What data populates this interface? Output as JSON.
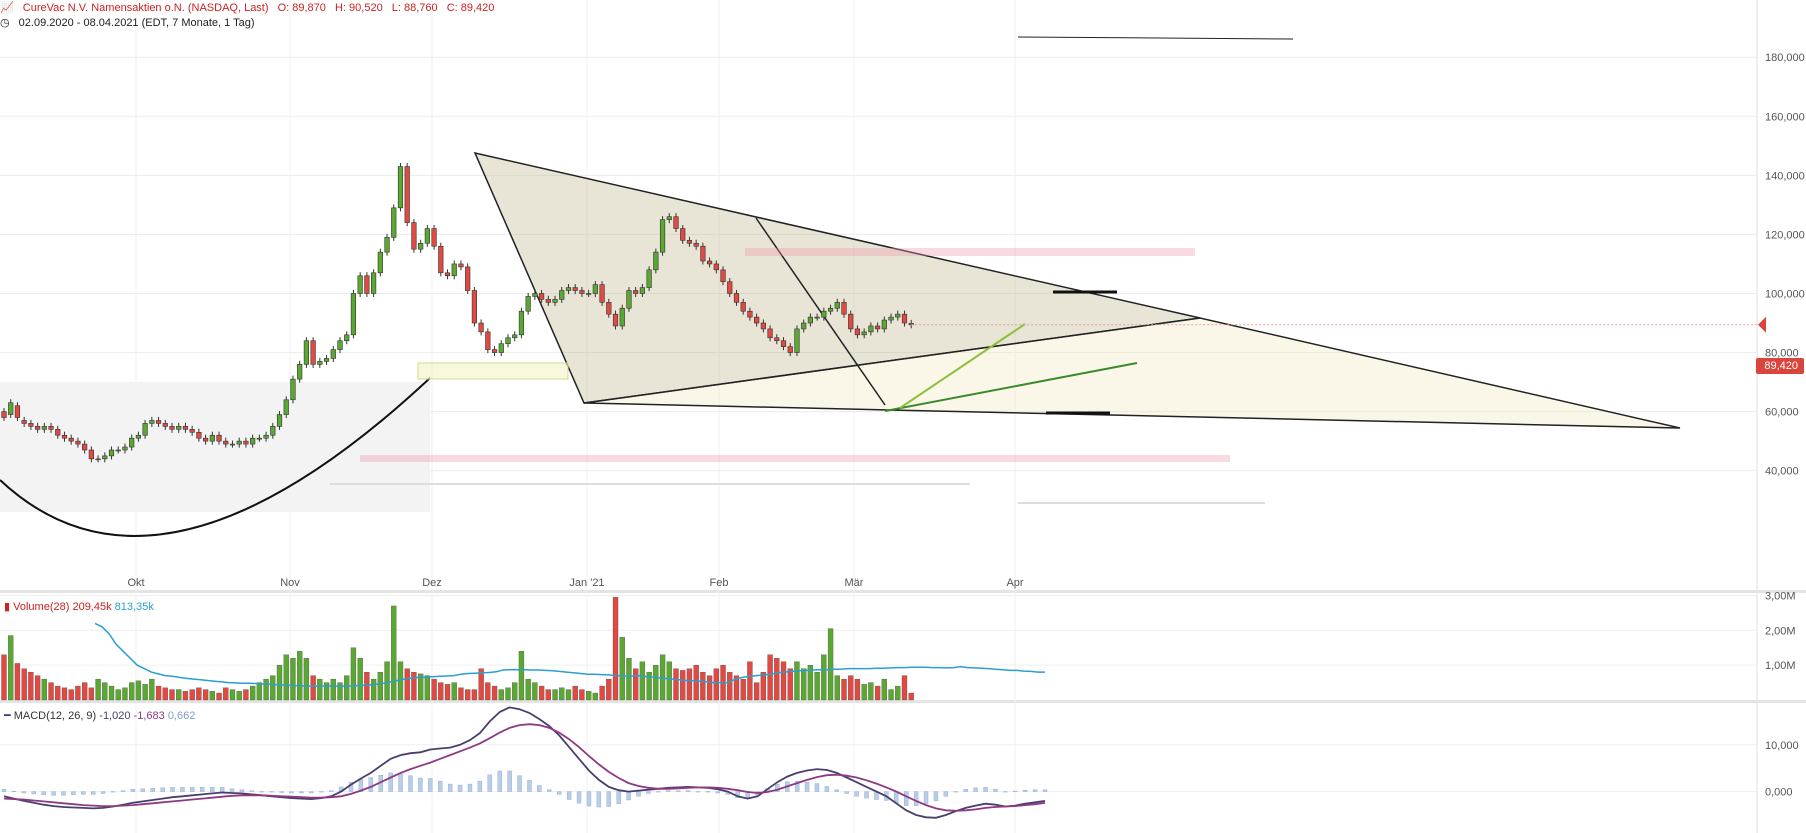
{
  "header": {
    "instrument": "CureVac N.V. Namensaktien   o.N. (NASDAQ, Last)",
    "open_label": "O: 89,870",
    "high_label": "H: 90,520",
    "low_label": "L: 88,760",
    "close_label": "C: 89,420",
    "period": "02.09.2020 - 08.04.2021   (EDT, 7 Monate, 1 Tag)"
  },
  "price_tag": "89,420",
  "volume_legend": {
    "title": "Volume(28)",
    "v1": "209,45k",
    "v2": "813,35k"
  },
  "macd_legend": {
    "title": "MACD(12, 26, 9)",
    "v1": "-1,020",
    "v2": "-1,683",
    "v3": "0,662"
  },
  "colors": {
    "up": "#5aa832",
    "down": "#e04a43",
    "volume_ma": "#2a9fd0",
    "macd_line": "#4a3e6e",
    "signal_line": "#8e3a82",
    "histogram": "#b9cde8"
  },
  "chart_data": [
    {
      "type": "candlestick",
      "title": "CureVac N.V. Namensaktien o.N. (NASDAQ, Last)",
      "x_tick_labels": [
        "Okt",
        "Nov",
        "Dez",
        "Jan '21",
        "Feb",
        "Mär",
        "Apr"
      ],
      "y_tick_labels": [
        "40,000",
        "60,000",
        "80,000",
        "100,000",
        "120,000",
        "140,000",
        "160,000",
        "180,000"
      ],
      "ylim": [
        26,
        196
      ],
      "last_close": 89.42,
      "closes": [
        58,
        63,
        58,
        56,
        55,
        54,
        55,
        54,
        52,
        51,
        50,
        49,
        47,
        44,
        44,
        45,
        47,
        47,
        48,
        51,
        52,
        56,
        57,
        56,
        55,
        54,
        55,
        54,
        53,
        51,
        50,
        52,
        50,
        49,
        49,
        50,
        49,
        51,
        51,
        52,
        55,
        59,
        64,
        71,
        76,
        84,
        76,
        77,
        78,
        81,
        84,
        86,
        100,
        106,
        100,
        107,
        114,
        119,
        129,
        143,
        124,
        115,
        117,
        122,
        116,
        107,
        106,
        110,
        109,
        101,
        90,
        87,
        81,
        80,
        83,
        85,
        86,
        94,
        99,
        100,
        98,
        97,
        98,
        101,
        102,
        101,
        100,
        100,
        103,
        97,
        93,
        89,
        95,
        101,
        100,
        102,
        108,
        114,
        125,
        126,
        122,
        118,
        117,
        116,
        111,
        110,
        108,
        104,
        100,
        97,
        94,
        92,
        90,
        88,
        85,
        84,
        82,
        80,
        88,
        90,
        92,
        92,
        94,
        95,
        97,
        93,
        88,
        86,
        87,
        89,
        88,
        91,
        92,
        93,
        90,
        89.42
      ],
      "opens": [
        60,
        59,
        62,
        57,
        56,
        55,
        54,
        55,
        54,
        52,
        51,
        50,
        49,
        47,
        44,
        44,
        45,
        47,
        47,
        48,
        51,
        52,
        56,
        57,
        56,
        55,
        54,
        55,
        54,
        53,
        51,
        50,
        52,
        50,
        49,
        49,
        50,
        49,
        51,
        51,
        52,
        55,
        59,
        64,
        71,
        76,
        84,
        76,
        77,
        78,
        81,
        84,
        86,
        100,
        106,
        100,
        107,
        114,
        119,
        129,
        143,
        124,
        115,
        117,
        122,
        116,
        107,
        106,
        110,
        109,
        101,
        90,
        87,
        81,
        80,
        83,
        85,
        86,
        94,
        99,
        100,
        98,
        97,
        98,
        101,
        102,
        101,
        100,
        100,
        103,
        97,
        93,
        89,
        95,
        101,
        100,
        102,
        108,
        114,
        125,
        126,
        122,
        118,
        117,
        116,
        111,
        110,
        108,
        104,
        100,
        97,
        94,
        92,
        90,
        88,
        85,
        84,
        82,
        80,
        88,
        90,
        92,
        92,
        94,
        95,
        97,
        93,
        88,
        86,
        87,
        89,
        88,
        91,
        92,
        93,
        89.87
      ],
      "annotations": {
        "triangle_vertices": [
          [
            "2020-12-09",
            151
          ],
          [
            "2021-05-25",
            72
          ],
          [
            "2020-12-30",
            79
          ]
        ],
        "curve": "rounding bottom Sep-Dec 2020"
      }
    },
    {
      "type": "bar",
      "title": "Volume(28)",
      "y_tick_labels": [
        "1,00M",
        "2,00M",
        "3,00M"
      ],
      "ylim": [
        0,
        3.1
      ],
      "values": [
        1.3,
        1.85,
        1.05,
        0.9,
        0.8,
        0.7,
        0.6,
        0.5,
        0.4,
        0.35,
        0.3,
        0.4,
        0.5,
        0.35,
        0.6,
        0.5,
        0.4,
        0.3,
        0.35,
        0.5,
        0.55,
        0.45,
        0.6,
        0.4,
        0.35,
        0.3,
        0.3,
        0.25,
        0.3,
        0.35,
        0.3,
        0.25,
        0.2,
        0.35,
        0.3,
        0.25,
        0.3,
        0.4,
        0.5,
        0.6,
        0.7,
        1.0,
        1.3,
        1.2,
        1.4,
        1.2,
        0.7,
        0.6,
        0.5,
        0.6,
        0.5,
        0.7,
        1.5,
        1.2,
        0.8,
        0.6,
        0.8,
        1.1,
        2.7,
        1.1,
        0.9,
        0.8,
        0.75,
        0.7,
        0.6,
        0.5,
        0.45,
        0.5,
        0.35,
        0.3,
        0.3,
        0.9,
        0.5,
        0.4,
        0.3,
        0.35,
        0.5,
        1.4,
        0.6,
        0.5,
        0.4,
        0.3,
        0.3,
        0.35,
        0.3,
        0.4,
        0.3,
        0.25,
        0.2,
        0.4,
        0.6,
        2.95,
        1.8,
        1.2,
        0.9,
        1.1,
        0.8,
        1.0,
        1.3,
        1.1,
        0.9,
        0.85,
        0.9,
        1.0,
        0.8,
        0.7,
        0.9,
        1.0,
        0.8,
        0.7,
        0.6,
        1.1,
        0.5,
        0.8,
        1.3,
        1.2,
        1.1,
        0.9,
        1.1,
        0.9,
        1.0,
        0.8,
        1.3,
        2.05,
        0.7,
        0.6,
        0.7,
        0.6,
        0.45,
        0.5,
        0.4,
        0.6,
        0.3,
        0.4,
        0.7,
        0.2
      ],
      "ma": [
        2.2,
        2.1,
        1.9,
        1.6,
        1.4,
        1.2,
        1.0,
        0.9,
        0.8,
        0.75,
        0.7,
        0.68,
        0.65,
        0.62,
        0.6,
        0.58,
        0.56,
        0.54,
        0.52,
        0.5,
        0.49,
        0.48,
        0.48,
        0.47,
        0.46,
        0.45,
        0.44,
        0.43,
        0.42,
        0.41,
        0.4,
        0.4,
        0.4,
        0.4,
        0.4,
        0.4,
        0.4,
        0.41,
        0.42,
        0.43,
        0.45,
        0.48,
        0.52,
        0.56,
        0.6,
        0.63,
        0.65,
        0.66,
        0.67,
        0.68,
        0.69,
        0.7,
        0.74,
        0.76,
        0.77,
        0.78,
        0.79,
        0.81,
        0.86,
        0.87,
        0.87,
        0.87,
        0.86,
        0.86,
        0.85,
        0.84,
        0.82,
        0.8,
        0.78,
        0.76,
        0.74,
        0.74,
        0.73,
        0.72,
        0.7,
        0.69,
        0.68,
        0.7,
        0.68,
        0.66,
        0.64,
        0.62,
        0.6,
        0.58,
        0.56,
        0.55,
        0.54,
        0.52,
        0.5,
        0.5,
        0.5,
        0.6,
        0.65,
        0.68,
        0.7,
        0.72,
        0.74,
        0.78,
        0.8,
        0.82,
        0.84,
        0.85,
        0.86,
        0.87,
        0.87,
        0.88,
        0.88,
        0.9,
        0.9,
        0.9,
        0.9,
        0.91,
        0.91,
        0.92,
        0.93,
        0.93,
        0.94,
        0.94,
        0.94,
        0.93,
        0.93,
        0.92,
        0.93,
        0.96,
        0.93,
        0.92,
        0.91,
        0.9,
        0.88,
        0.87,
        0.85,
        0.85,
        0.83,
        0.82,
        0.8,
        0.8
      ]
    },
    {
      "type": "line",
      "title": "MACD(12, 26, 9)",
      "y_tick_labels": [
        "0,000",
        "10,000"
      ],
      "ylim": [
        -8,
        20
      ],
      "series": [
        {
          "name": "MACD",
          "values": [
            -1,
            -1.5,
            -2,
            -2.4,
            -2.8,
            -3.1,
            -3.3,
            -3.4,
            -3.5,
            -3.6,
            -3.5,
            -3.2,
            -2.8,
            -2.4,
            -2.1,
            -1.8,
            -1.5,
            -1.2,
            -1.0,
            -0.8,
            -0.6,
            -0.4,
            -0.2,
            -0.3,
            -0.4,
            -0.6,
            -0.8,
            -1.0,
            -1.2,
            -1.4,
            -1.5,
            -1.6,
            -1.4,
            -1.0,
            0,
            1.5,
            2.8,
            4.0,
            5.5,
            7.0,
            7.8,
            8.2,
            8.4,
            9.0,
            9.2,
            9.4,
            10.0,
            11.0,
            12.5,
            15.0,
            17.0,
            18.0,
            17.6,
            16.8,
            15.5,
            14.0,
            12.0,
            9.5,
            7.0,
            4.5,
            2.5,
            1.0,
            0.3,
            0.0,
            0.2,
            0.4,
            0.6,
            0.8,
            0.9,
            1.0,
            0.9,
            0.8,
            0.5,
            0.0,
            -1.0,
            -1.5,
            -1.0,
            0.5,
            2.0,
            3.2,
            4.0,
            4.5,
            4.8,
            4.6,
            4.0,
            3.0,
            2.0,
            1.0,
            0.0,
            -1.0,
            -2.5,
            -4.0,
            -5.0,
            -5.5,
            -5.6,
            -5.0,
            -4.2,
            -3.5,
            -3.0,
            -2.6,
            -2.8,
            -3.2,
            -3.0,
            -2.6,
            -2.3,
            -2.0
          ]
        },
        {
          "name": "Signal",
          "values": [
            -1.5,
            -1.6,
            -1.7,
            -1.9,
            -2.1,
            -2.3,
            -2.5,
            -2.7,
            -2.9,
            -3.0,
            -3.1,
            -3.1,
            -3.0,
            -2.9,
            -2.7,
            -2.5,
            -2.3,
            -2.1,
            -1.9,
            -1.7,
            -1.5,
            -1.3,
            -1.1,
            -0.9,
            -0.8,
            -0.8,
            -0.8,
            -0.9,
            -1.0,
            -1.1,
            -1.2,
            -1.3,
            -1.3,
            -1.2,
            -1.0,
            -0.5,
            0.2,
            1.0,
            2.0,
            3.0,
            4.0,
            4.8,
            5.5,
            6.2,
            7.0,
            7.8,
            8.6,
            9.4,
            10.3,
            11.4,
            12.6,
            13.6,
            14.2,
            14.4,
            14.2,
            13.6,
            12.6,
            11.2,
            9.5,
            7.6,
            5.8,
            4.2,
            2.9,
            1.8,
            1.2,
            0.8,
            0.6,
            0.6,
            0.7,
            0.8,
            0.9,
            0.9,
            0.8,
            0.6,
            0.3,
            -0.1,
            -0.3,
            -0.1,
            0.4,
            1.1,
            1.8,
            2.5,
            3.1,
            3.5,
            3.6,
            3.4,
            3.0,
            2.4,
            1.7,
            0.9,
            0.0,
            -1.0,
            -2.0,
            -2.9,
            -3.6,
            -4.0,
            -4.1,
            -4.0,
            -3.8,
            -3.5,
            -3.3,
            -3.2,
            -3.1,
            -2.9,
            -2.7,
            -2.4
          ]
        }
      ],
      "histogram": [
        0.5,
        0.1,
        -0.3,
        -0.5,
        -0.7,
        -0.8,
        -0.8,
        -0.7,
        -0.6,
        -0.6,
        -0.4,
        -0.1,
        0.2,
        0.5,
        0.6,
        0.7,
        0.8,
        0.9,
        0.9,
        0.9,
        0.9,
        0.9,
        0.9,
        0.6,
        0.4,
        0.2,
        0.0,
        -0.1,
        -0.2,
        -0.3,
        -0.3,
        -0.3,
        -0.1,
        0.2,
        1.0,
        2.0,
        2.6,
        3.0,
        3.5,
        4.0,
        3.8,
        3.4,
        2.9,
        2.8,
        2.2,
        1.6,
        1.4,
        1.6,
        2.2,
        3.6,
        4.4,
        4.4,
        3.4,
        2.4,
        1.3,
        0.4,
        -0.6,
        -1.7,
        -2.5,
        -3.1,
        -3.3,
        -3.2,
        -2.6,
        -1.8,
        -1.0,
        -0.4,
        0.0,
        0.2,
        0.2,
        0.2,
        0.0,
        -0.1,
        -0.3,
        -0.6,
        -1.3,
        -1.4,
        -0.7,
        0.6,
        1.6,
        2.1,
        2.2,
        2.0,
        1.7,
        1.1,
        0.4,
        -0.4,
        -1.0,
        -1.4,
        -1.7,
        -1.9,
        -2.5,
        -3.0,
        -3.0,
        -2.6,
        -2.0,
        -1.0,
        -0.1,
        0.5,
        0.8,
        0.9,
        0.5,
        0.0,
        0.1,
        0.3,
        0.4,
        0.4
      ]
    }
  ]
}
